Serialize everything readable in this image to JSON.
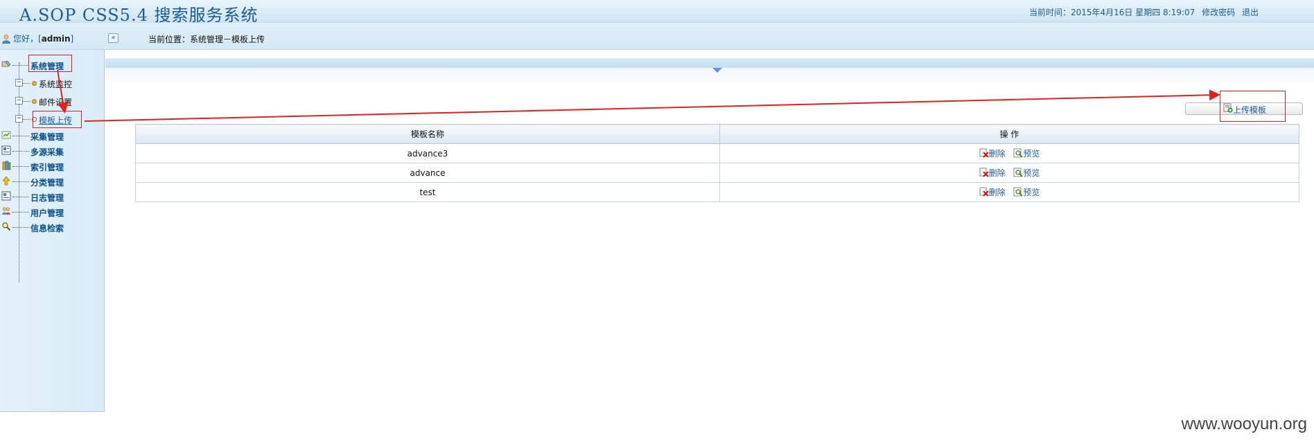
{
  "header": {
    "app_title": "A.SOP CSS5.4 搜索服务系统",
    "time_label": "当前时间：2015年4月16日 星期四 8:19:07",
    "change_password": "修改密码",
    "logout": "退出"
  },
  "subheader": {
    "welcome_prefix": "您好，[",
    "username": "admin",
    "welcome_suffix": "]",
    "collapse_glyph": "«",
    "breadcrumb": "当前位置：系统管理－模板上传"
  },
  "sidebar": {
    "items": [
      {
        "label": "系统管理",
        "icon": "system-icon"
      },
      {
        "label": "系统监控"
      },
      {
        "label": "邮件设置"
      },
      {
        "label": "模板上传"
      },
      {
        "label": "采集管理",
        "icon": "collect-icon"
      },
      {
        "label": "多源采集",
        "icon": "multi-source-icon"
      },
      {
        "label": "索引管理",
        "icon": "index-icon"
      },
      {
        "label": "分类管理",
        "icon": "category-icon"
      },
      {
        "label": "日志管理",
        "icon": "log-icon"
      },
      {
        "label": "用户管理",
        "icon": "users-icon"
      },
      {
        "label": "信息检索",
        "icon": "search-icon"
      }
    ]
  },
  "main": {
    "upload_button": "上传模板",
    "table": {
      "columns": [
        "模板名称",
        "操 作"
      ],
      "rows": [
        {
          "name": "advance3"
        },
        {
          "name": "advance"
        },
        {
          "name": "test"
        }
      ],
      "delete_label": "删除",
      "preview_label": "预览"
    }
  },
  "watermark": "www.wooyun.org",
  "colors": {
    "brand": "#1c5c97",
    "annotation": "#e3211c"
  }
}
